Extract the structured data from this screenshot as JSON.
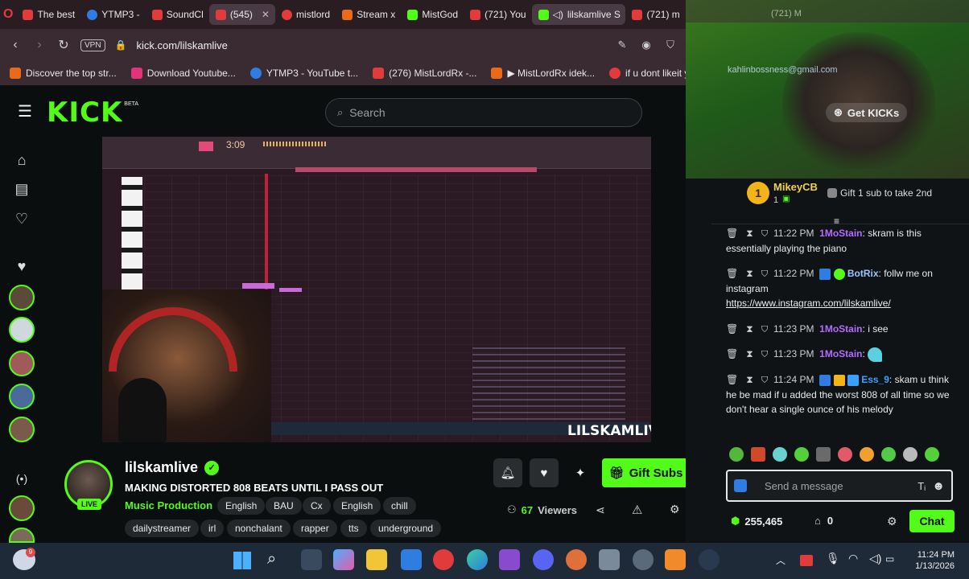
{
  "tabs": [
    {
      "label": "The best",
      "color": "#e23b3b"
    },
    {
      "label": "YTMP3 -",
      "color": "#2f7de0"
    },
    {
      "label": "SoundCl",
      "color": "#e23b3b"
    },
    {
      "label": "(545)",
      "color": "#e23b3b"
    },
    {
      "label": "mistlord",
      "color": "#e23b3b"
    },
    {
      "label": "Stream x",
      "color": "#e86a1a"
    },
    {
      "label": "MistGod",
      "color": "#53fc18"
    },
    {
      "label": "(721) You",
      "color": "#e23b3b"
    },
    {
      "label": "lilskamlive S",
      "color": "#53fc18"
    },
    {
      "label": "(721) m",
      "color": "#e23b3b"
    }
  ],
  "address": {
    "vpn": "VPN",
    "url": "kick.com/lilskamlive"
  },
  "bookmarks": [
    {
      "label": "Discover the top str...",
      "color": "#e86a1a"
    },
    {
      "label": "Download Youtube...",
      "color": "#e0357a"
    },
    {
      "label": "YTMP3 - YouTube t...",
      "color": "#2f7de0"
    },
    {
      "label": "(276) MistLordRx -...",
      "color": "#e23b3b"
    },
    {
      "label": "▶ MistLordRx idek...",
      "color": "#e86a1a"
    },
    {
      "label": "if u dont likeit you b...",
      "color": "#e23b3b"
    }
  ],
  "header": {
    "logo": "KICK",
    "logo_badge": "BETA",
    "search_placeholder": "Search"
  },
  "video": {
    "watermark": "LILSKAMLIVE",
    "daw_time": "3:09"
  },
  "stream": {
    "channel": "lilskamlive",
    "title": "MAKING DISTORTED 808 BEATS UNTIL I PASS OUT",
    "category": "Music Production",
    "tags_row1": [
      "English",
      "BAU",
      "Cx",
      "English",
      "chill"
    ],
    "tags_row2": [
      "dailystreamer",
      "irl",
      "nonchalant",
      "rapper",
      "tts",
      "underground"
    ],
    "live": "LIVE",
    "viewers": "67",
    "viewers_label": "Viewers",
    "gift_subs": "Gift Subs"
  },
  "webcam": {
    "email": "kahlinbossness@gmail.com",
    "overlay_btn": "Get KICKs",
    "tab": "(721) M"
  },
  "leaderboard": {
    "rank": "1",
    "user": "MikeyCB",
    "count": "1",
    "gift_text": "Gift 1 sub to take 2nd"
  },
  "chat": {
    "messages": [
      {
        "time": "11:22 PM",
        "user": "1MoStain",
        "user_color": "#b46cff",
        "text": "skram is this essentially playing the piano"
      },
      {
        "time": "11:22 PM",
        "user": "BotRix",
        "user_color": "#9dc4ff",
        "text": "follw me on instagram",
        "link": "https://www.instagram.com/lilskamlive/"
      },
      {
        "time": "11:23 PM",
        "user": "1MoStain",
        "user_color": "#b46cff",
        "text": "i see"
      },
      {
        "time": "11:23 PM",
        "user": "1MoStain",
        "user_color": "#b46cff",
        "text": ""
      },
      {
        "time": "11:24 PM",
        "user": "Ess_9",
        "user_color": "#3aa0ff",
        "text": "skam u think he be mad if u added the worst 808 of all time so we don't hear a single ounce of his melody"
      }
    ],
    "input_placeholder": "Send a message",
    "points": "255,465",
    "store_count": "0",
    "chat_button": "Chat"
  },
  "taskbar": {
    "time": "11:24 PM",
    "date": "1/13/2026",
    "badge": "9"
  }
}
